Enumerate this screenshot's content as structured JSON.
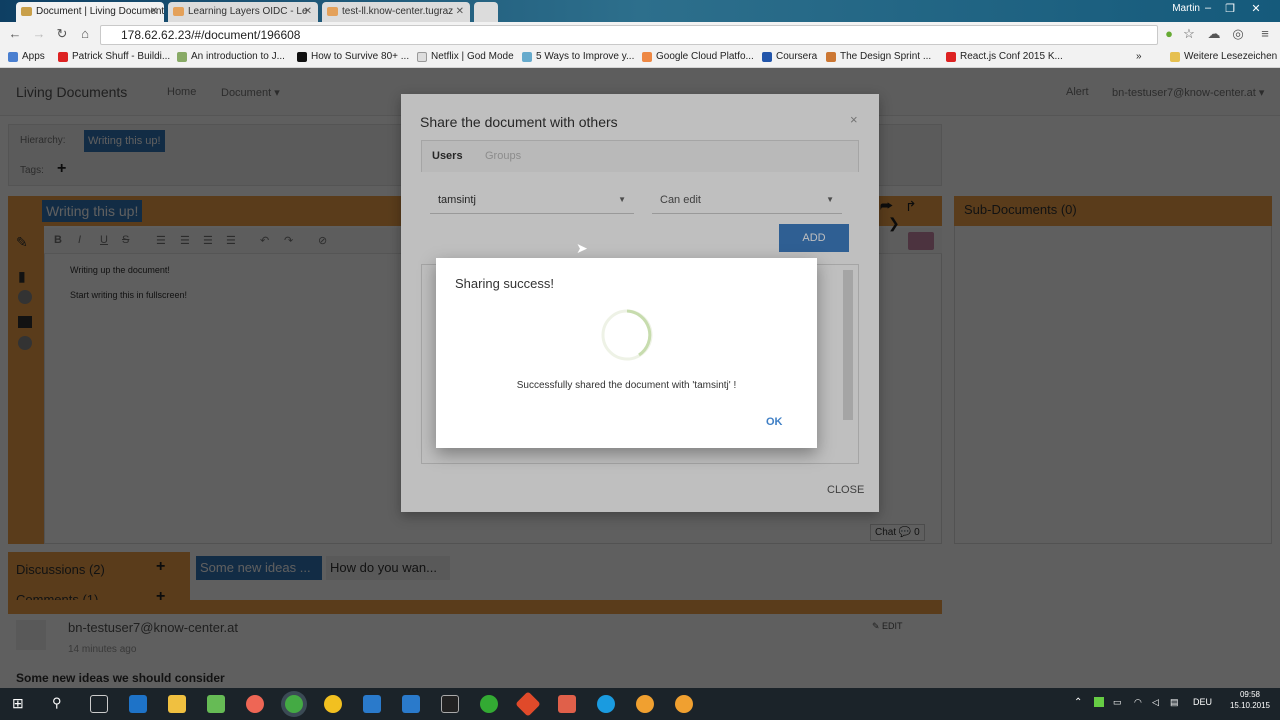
{
  "browser": {
    "tabs": [
      {
        "label": "Document | Living Documents",
        "active": true
      },
      {
        "label": "Learning Layers OIDC - Le",
        "active": false
      },
      {
        "label": "test-ll.know-center.tugraz",
        "active": false
      }
    ],
    "window_user": "Martin",
    "url": "178.62.62.23/#/document/196608",
    "bookmarks": [
      "Apps",
      "Patrick Shuff - Buildi...",
      "An introduction to J...",
      "How to Survive 80+ ...",
      "Netflix | God Mode",
      "5 Ways to Improve y...",
      "Google Cloud Platfo...",
      "Coursera",
      "The Design Sprint ...",
      "React.js Conf 2015 K...",
      "»",
      "Weitere Lesezeichen"
    ]
  },
  "app": {
    "brand": "Living Documents",
    "nav": {
      "home": "Home",
      "document": "Document ▾",
      "alert": "Alert",
      "user": "bn-testuser7@know-center.at ▾"
    },
    "hierarchy_label": "Hierarchy:",
    "hierarchy_item": "Writing this up!",
    "tags_label": "Tags:",
    "doc_title": "Writing this up!",
    "editor_lines": [
      "Writing up the document!",
      "Start writing this in fullscreen!"
    ],
    "sub_documents": "Sub-Documents (0)",
    "discussions": "Discussions (2)",
    "comments": "Comments (1)",
    "discussion_tabs": [
      "Some new ideas ...",
      "How do you wan..."
    ],
    "comment_author": "bn-testuser7@know-center.at",
    "comment_time": "14 minutes ago",
    "comment_text": "Some new ideas we should consider",
    "edit": "✎ EDIT",
    "chat": "Chat 💬 0"
  },
  "share_modal": {
    "title": "Share the document with others",
    "tab_users": "Users",
    "tab_groups": "Groups",
    "user_value": "tamsintj",
    "permission_value": "Can edit",
    "add_label": "ADD",
    "close_label": "CLOSE"
  },
  "success_modal": {
    "title": "Sharing success!",
    "message": "Successfully shared the document with 'tamsintj' !",
    "ok_label": "OK"
  },
  "taskbar": {
    "lang": "DEU",
    "time": "09:58",
    "date": "15.10.2015"
  }
}
